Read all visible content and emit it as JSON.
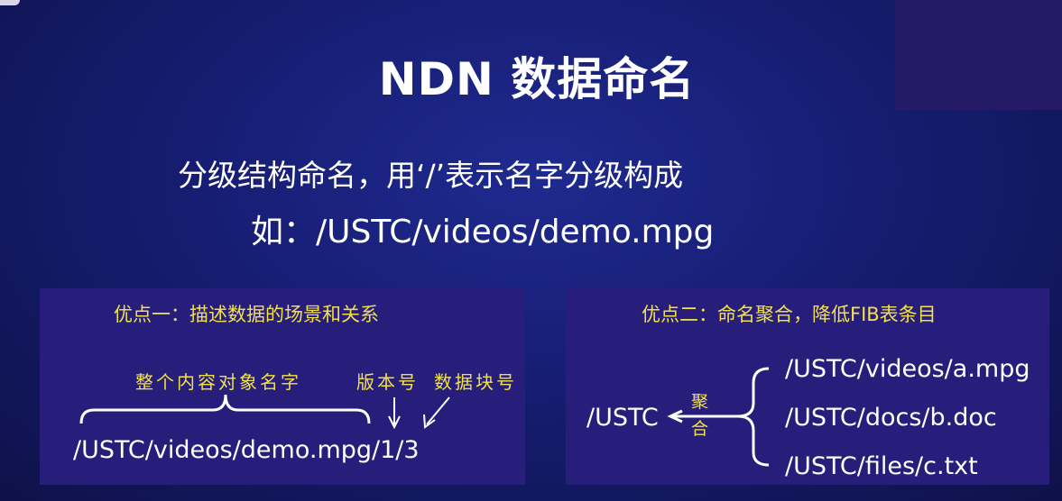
{
  "slide": {
    "title": "NDN 数据命名",
    "line1": "分级结构命名，用‘/’表示名字分级构成",
    "line2": "如：/USTC/videos/demo.mpg"
  },
  "left_panel": {
    "title": "优点一：描述数据的场景和关系",
    "label_whole": "整个内容对象名字",
    "label_version": "版本号",
    "label_block": "数据块号",
    "path": "/USTC/videos/demo.mpg/1/3"
  },
  "right_panel": {
    "title": "优点二：命名聚合，降低FIB表条目",
    "root": "/USTC",
    "agg_1": "聚",
    "agg_2": "合",
    "items": [
      "/USTC/videos/a.mpg",
      "/USTC/docs/b.doc",
      "/USTC/files/c.txt"
    ]
  },
  "colors": {
    "accent_yellow": "#f2e14a",
    "panel_bg": "#271d7b",
    "slide_bg": "#161d72"
  }
}
